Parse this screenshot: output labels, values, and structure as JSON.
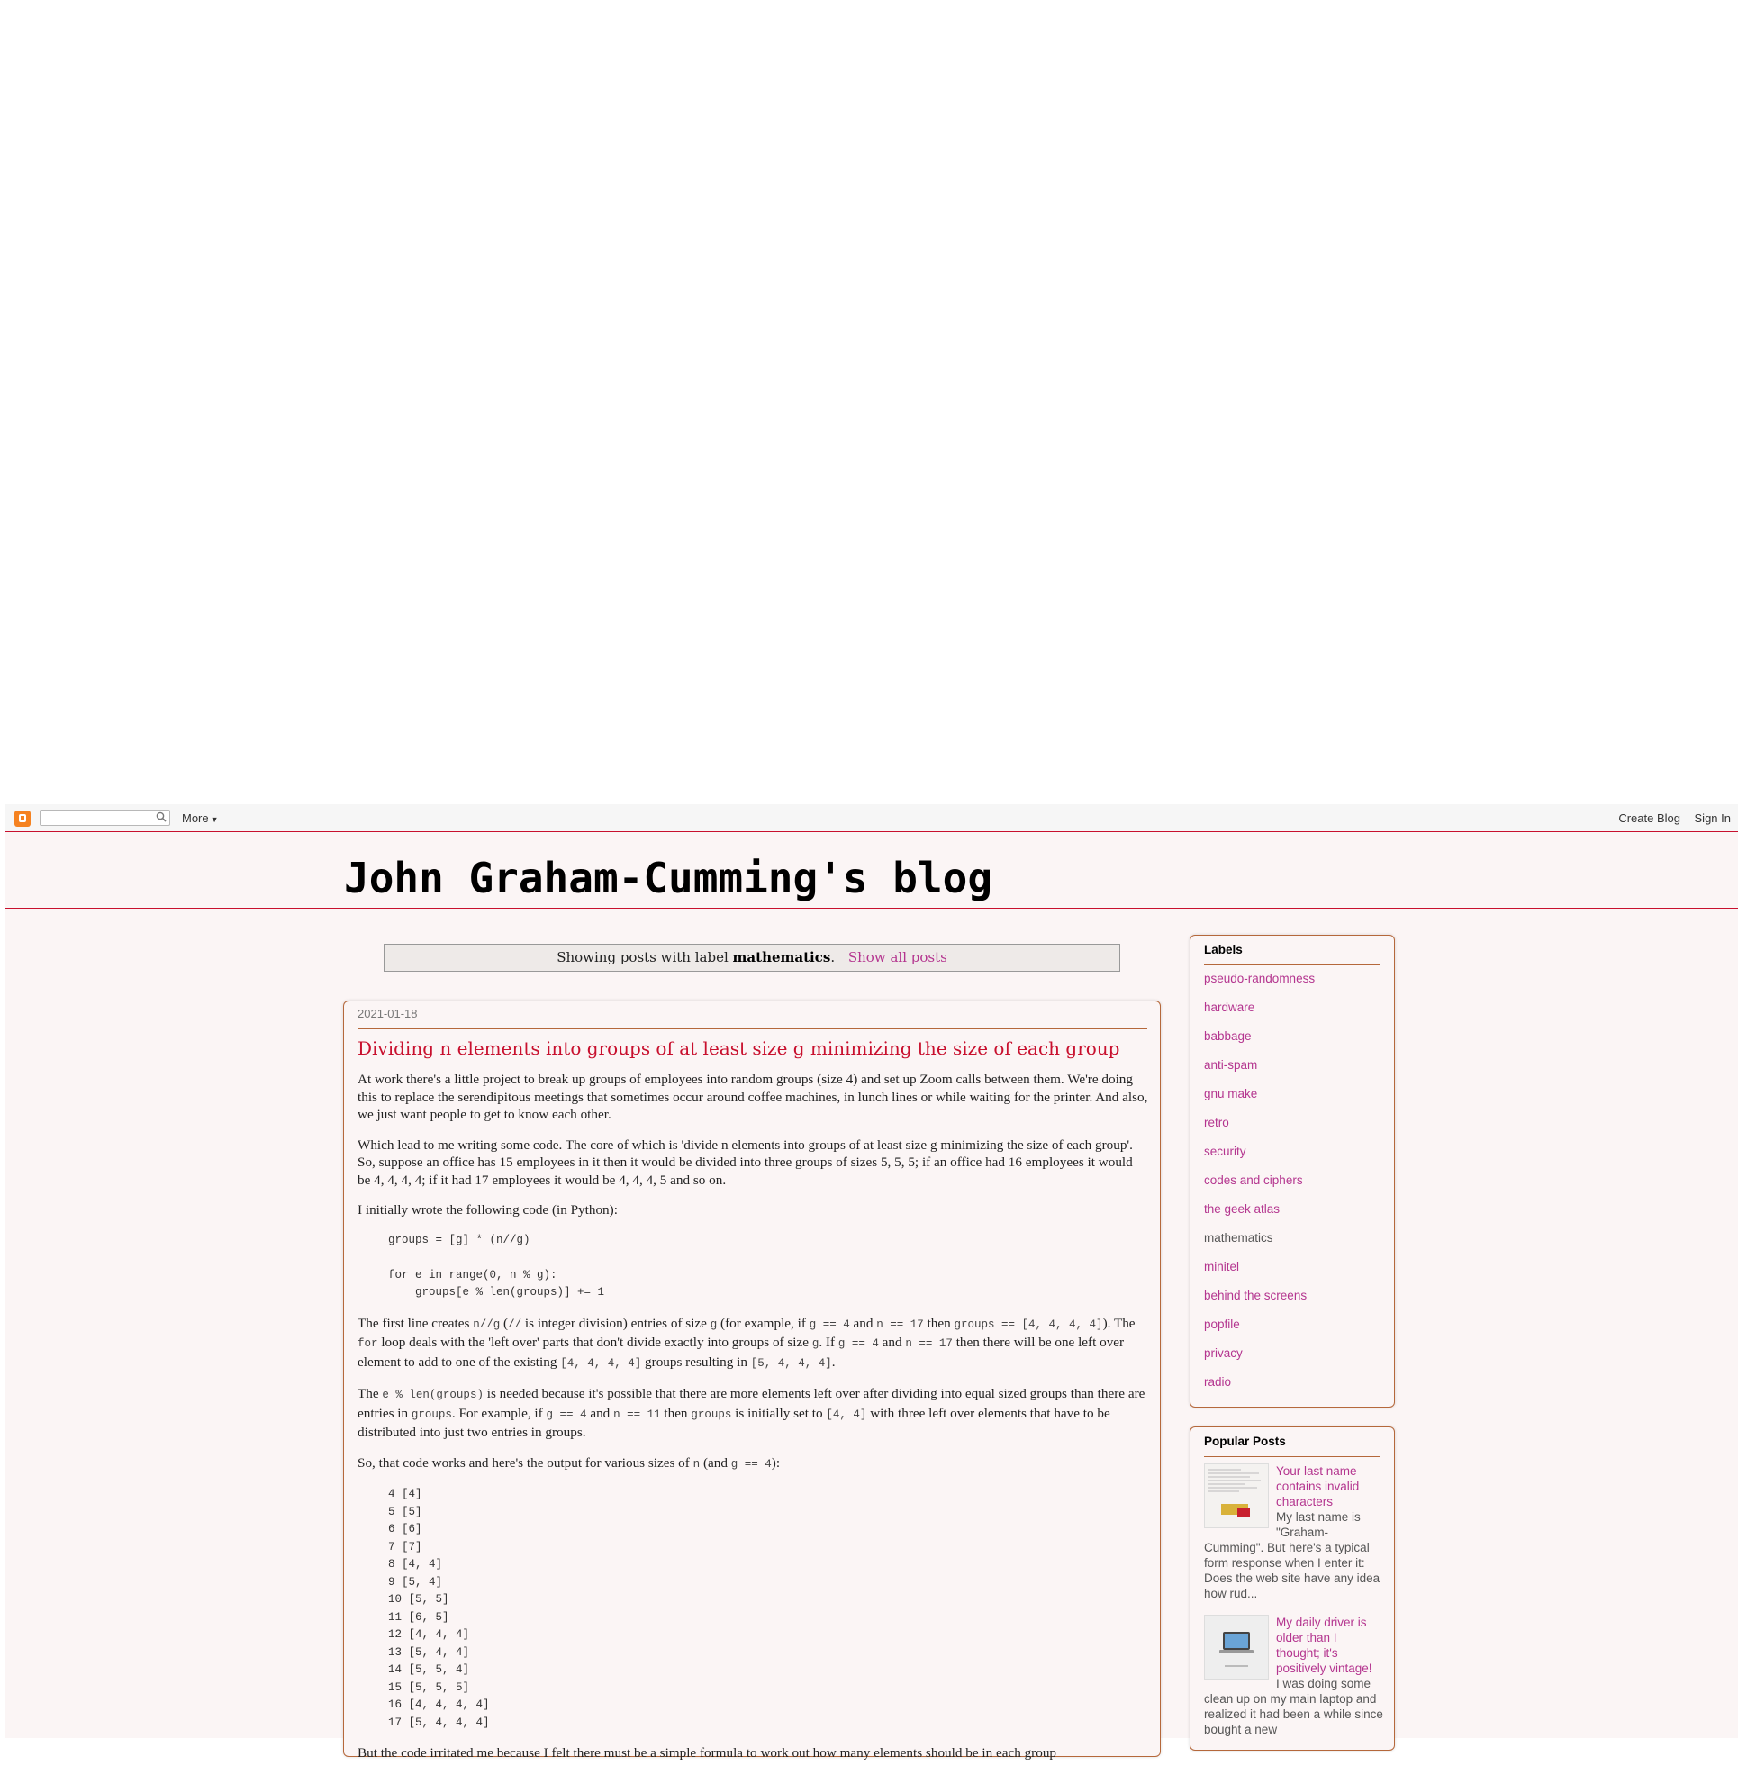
{
  "navbar": {
    "search_placeholder": "",
    "more_label": "More",
    "create_blog_label": "Create Blog",
    "sign_in_label": "Sign In"
  },
  "header": {
    "title": "John Graham-Cumming's blog"
  },
  "status": {
    "prefix": "Showing posts with label",
    "label": "mathematics",
    "suffix": ".",
    "show_all": "Show all posts"
  },
  "post": {
    "date": "2021-01-18",
    "title": "Dividing n elements into groups of at least size g minimizing the size of each group",
    "p1": "At work there's a little project to break up groups of employees into random groups (size 4) and set up Zoom calls between them. We're doing this to replace the serendipitous meetings that sometimes occur around coffee machines, in lunch lines or while waiting for the printer. And also, we just want people to get to know each other.",
    "p2": "Which lead to me writing some code. The core of which is 'divide n elements into groups of at least size g minimizing the size of each group'. So, suppose an office has 15 employees in it then it would be divided into three groups of sizes 5, 5, 5; if an office had 16 employees it would be 4, 4, 4, 4; if it had 17 employees it would be 4, 4, 4, 5 and so on.",
    "p3": "I initially wrote the following code (in Python):",
    "code1": "groups = [g] * (n//g)\n\nfor e in range(0, n % g):\n    groups[e % len(groups)] += 1",
    "p4_parts": [
      "The first line creates ",
      "n//g",
      " (",
      "//",
      " is integer division) entries of size ",
      "g",
      " (for example, if ",
      "g == 4",
      " and ",
      "n == 17",
      " then ",
      "groups == [4, 4, 4, 4]",
      "). The ",
      "for",
      " loop deals with the 'left over' parts that don't divide exactly into groups of size ",
      "g",
      ". If ",
      "g == 4",
      " and ",
      "n == 17",
      " then there will be one left over element to add to one of the existing ",
      "[4, 4, 4, 4]",
      " groups resulting in ",
      "[5, 4, 4, 4]",
      "."
    ],
    "p5_parts": [
      "The ",
      "e % len(groups)",
      " is needed because it's possible that there are more elements left over after dividing into equal sized groups than there are entries in ",
      "groups",
      ". For example, if ",
      "g == 4",
      " and ",
      "n == 11",
      " then ",
      "groups",
      " is initially set to ",
      "[4, 4]",
      " with three left over elements that have to be distributed into just two entries in groups."
    ],
    "p6_parts": [
      "So, that code works and here's the output for various sizes of ",
      "n",
      " (and ",
      "g == 4",
      "):"
    ],
    "code2": "4 [4]\n5 [5]\n6 [6]\n7 [7]\n8 [4, 4]\n9 [5, 4]\n10 [5, 5]\n11 [6, 5]\n12 [4, 4, 4]\n13 [5, 4, 4]\n14 [5, 5, 4]\n15 [5, 5, 5]\n16 [4, 4, 4, 4]\n17 [5, 4, 4, 4]",
    "p7": "But the code irritated me because I felt there must be a simple formula to work out how many elements should be in each group"
  },
  "labels_widget": {
    "title": "Labels",
    "items": [
      {
        "label": "pseudo-randomness",
        "current": false
      },
      {
        "label": "hardware",
        "current": false
      },
      {
        "label": "babbage",
        "current": false
      },
      {
        "label": "anti-spam",
        "current": false
      },
      {
        "label": "gnu make",
        "current": false
      },
      {
        "label": "retro",
        "current": false
      },
      {
        "label": "security",
        "current": false
      },
      {
        "label": "codes and ciphers",
        "current": false
      },
      {
        "label": "the geek atlas",
        "current": false
      },
      {
        "label": "mathematics",
        "current": true
      },
      {
        "label": "minitel",
        "current": false
      },
      {
        "label": "behind the screens",
        "current": false
      },
      {
        "label": "popfile",
        "current": false
      },
      {
        "label": "privacy",
        "current": false
      },
      {
        "label": "radio",
        "current": false
      }
    ]
  },
  "popular_posts": {
    "title": "Popular Posts",
    "items": [
      {
        "title": "Your last name contains invalid characters",
        "snippet": "My last name is \"Graham-Cumming\". But here's a typical form response when I enter it: Does the web site have any idea how rud..."
      },
      {
        "title": "My daily driver is older than I thought; it's positively vintage!",
        "snippet": "I was doing some clean up on my main laptop and realized it had been a while since bought a new"
      }
    ]
  },
  "colors": {
    "accent_red": "#c8102e",
    "link_magenta": "#b4358f",
    "border_brown": "#b5683b",
    "page_bg": "#fbf5f5"
  }
}
